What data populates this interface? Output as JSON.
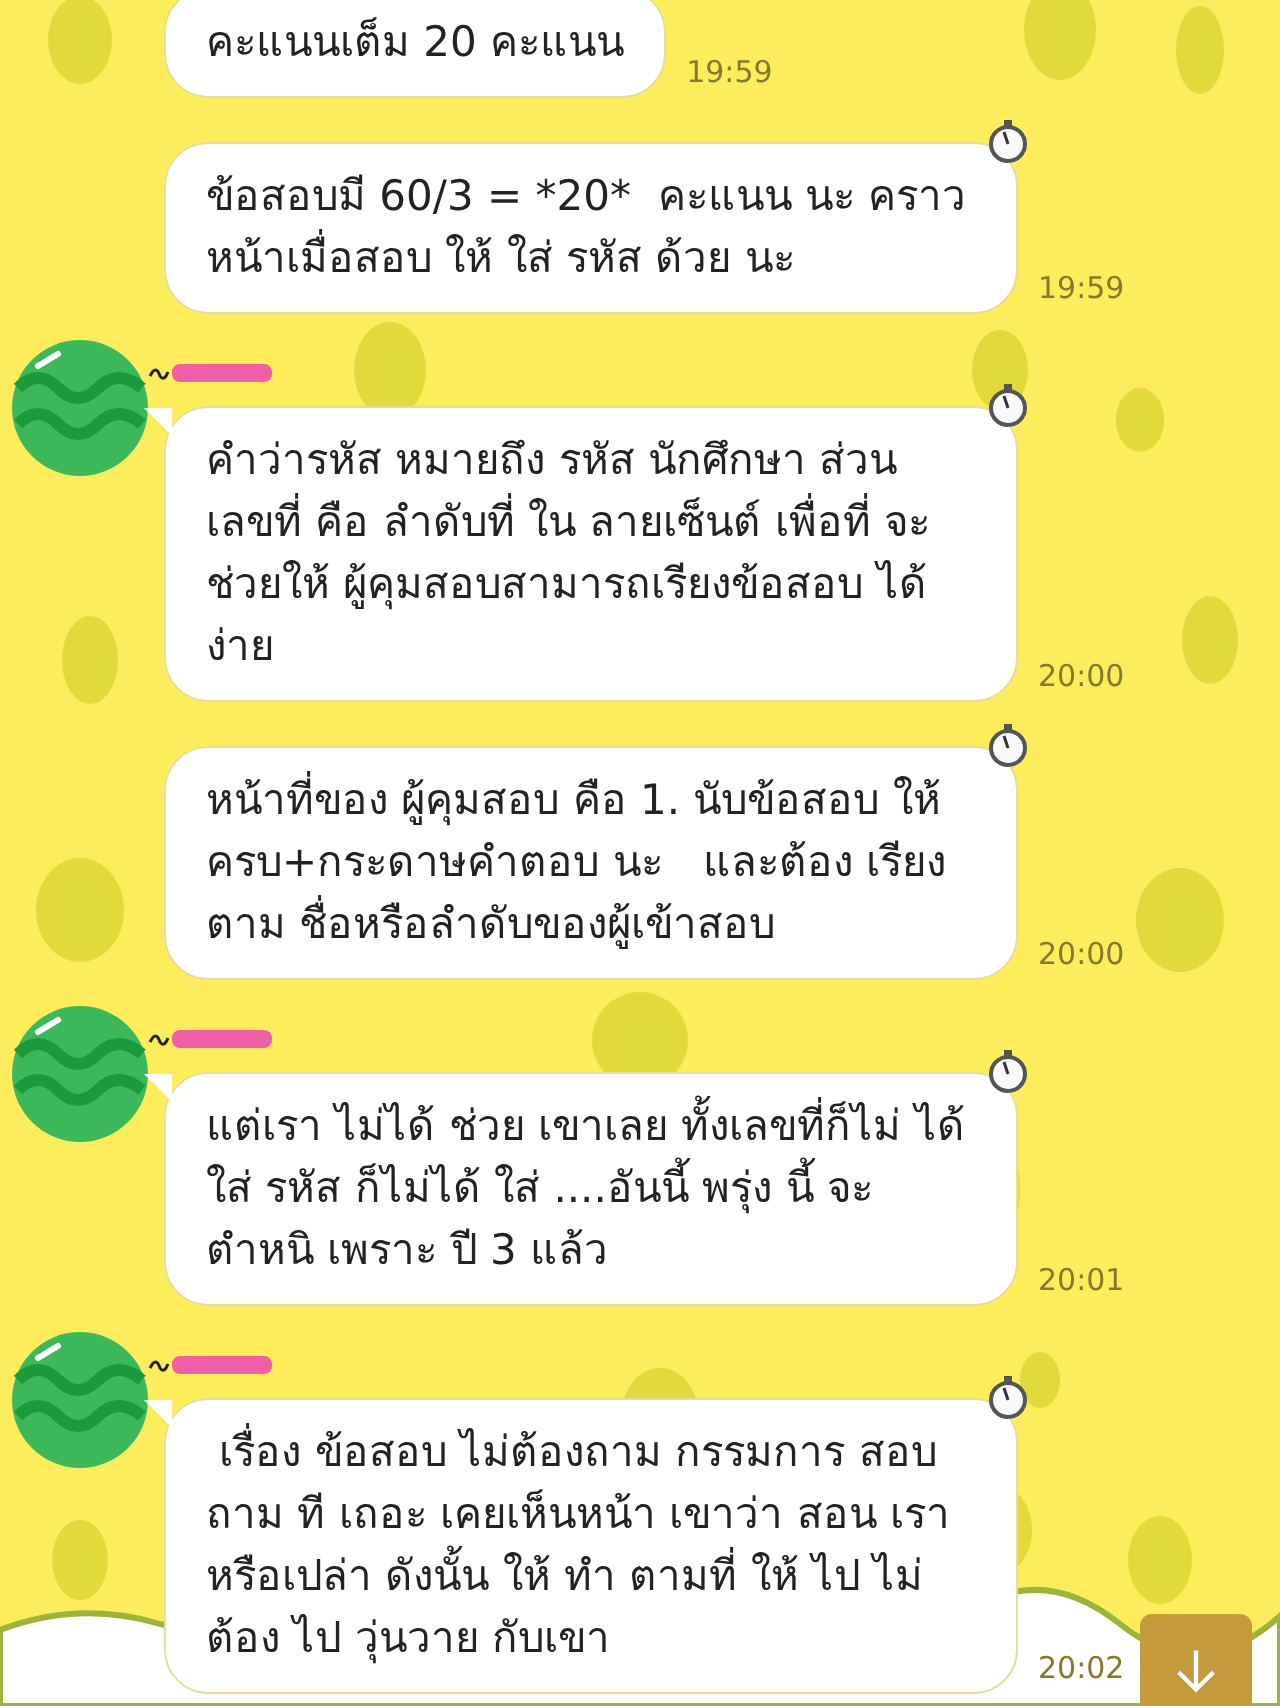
{
  "messages": [
    {
      "avatar": false,
      "timer": false,
      "text": "คะแนนเต็ม 20 คะแนน",
      "time": "19:59"
    },
    {
      "avatar": false,
      "timer": true,
      "text": "ข้อสอบมี 60/3 = *20*  คะแนน นะ คราวหน้าเมื่อสอบ ให้ ใส่ รหัส ด้วย นะ",
      "time": "19:59"
    },
    {
      "avatar": true,
      "timer": true,
      "text": "คำว่ารหัส หมายถึง รหัส นักศึกษา ส่วน เลขที่ คือ ลำดับที่ ใน ลายเซ็นต์ เพื่อที่ จะช่วยให้ ผู้คุมสอบสามารถเรียงข้อสอบ ได้ ง่าย",
      "time": "20:00"
    },
    {
      "avatar": false,
      "timer": true,
      "text": "หน้าที่ของ ผู้คุมสอบ คือ 1. นับข้อสอบ ให้ ครบ+กระดาษคำตอบ นะ   และต้อง เรียง ตาม ชื่อหรือลำดับของผู้เข้าสอบ",
      "time": "20:00"
    },
    {
      "avatar": true,
      "timer": true,
      "text": "แต่เรา ไม่ได้ ช่วย เขาเลย ทั้งเลขที่ก็ไม่ ได้ ใส่ รหัส ก็ไม่ได้ ใส่ ....อันนี้ พรุ่ง นี้ จะ ตำหนิ เพราะ ปี 3 แล้ว",
      "time": "20:01"
    },
    {
      "avatar": true,
      "timer": true,
      "text": " เรื่อง ข้อสอบ ไม่ต้องถาม กรรมการ สอบ ถาม ที เถอะ เคยเห็นหน้า เขาว่า สอน เราหรือเปล่า ดังนั้น ให้ ทำ ตามที่ ให้ ไป ไม่ ต้อง ไป วุ่นวาย กับเขา",
      "time": "20:02"
    }
  ]
}
